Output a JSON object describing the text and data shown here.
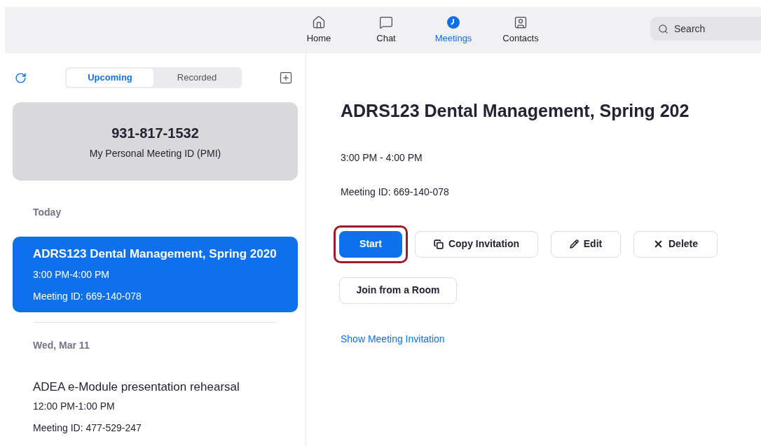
{
  "nav": [
    {
      "kind": "home",
      "label": "Home",
      "selected": false
    },
    {
      "kind": "chat",
      "label": "Chat",
      "selected": false
    },
    {
      "kind": "meetings",
      "label": "Meetings",
      "selected": true
    },
    {
      "kind": "contacts",
      "label": "Contacts",
      "selected": false
    }
  ],
  "search": {
    "placeholder": "Search"
  },
  "segments": [
    {
      "label": "Upcoming",
      "selected": true
    },
    {
      "label": "Recorded",
      "selected": false
    }
  ],
  "pmi": {
    "number": "931-817-1532",
    "label": "My Personal Meeting ID (PMI)"
  },
  "groups": [
    {
      "heading": "Today",
      "meetings": [
        {
          "title": "ADRS123 Dental Management, Spring 2020",
          "time": "3:00 PM-4:00 PM",
          "meeting_id": "Meeting ID: 669-140-078",
          "selected": true
        }
      ]
    },
    {
      "heading": "Wed, Mar 11",
      "meetings": [
        {
          "title": "ADEA e-Module presentation rehearsal",
          "time": "12:00 PM-1:00 PM",
          "meeting_id": "Meeting ID: 477-529-247",
          "selected": false
        }
      ]
    }
  ],
  "detail": {
    "title": "ADRS123 Dental Management, Spring 202",
    "time": "3:00 PM - 4:00 PM",
    "meeting_id": "Meeting ID: 669-140-078",
    "buttons": [
      {
        "kind": "primary",
        "label": "Start",
        "highlighted": true
      },
      {
        "kind": "copy",
        "label": "Copy Invitation",
        "highlighted": false
      },
      {
        "kind": "edit",
        "label": "Edit",
        "highlighted": false
      },
      {
        "kind": "delete",
        "label": "Delete",
        "highlighted": false
      },
      {
        "kind": "plain",
        "label": "Join from a Room",
        "highlighted": false
      }
    ],
    "link": "Show Meeting Invitation"
  }
}
